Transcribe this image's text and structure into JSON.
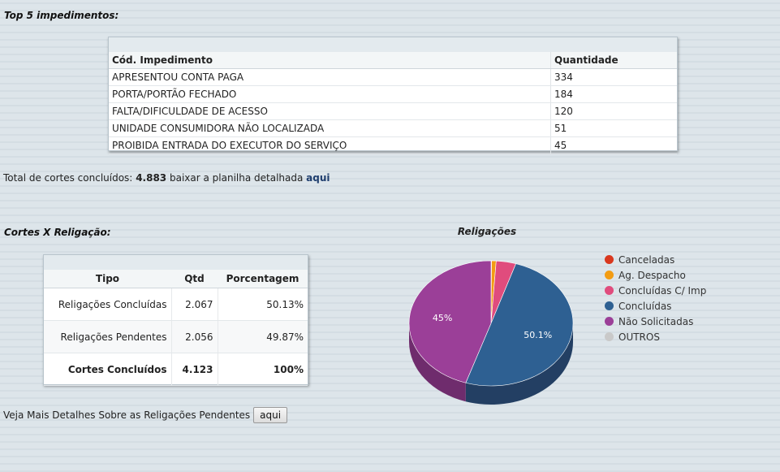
{
  "top5": {
    "title": "Top 5 impedimentos:",
    "headers": [
      "Cód. Impedimento",
      "Quantidade"
    ],
    "rows": [
      {
        "name": "APRESENTOU CONTA PAGA",
        "qty": "334"
      },
      {
        "name": "PORTA/PORTÃO FECHADO",
        "qty": "184"
      },
      {
        "name": "FALTA/DIFICULDADE DE ACESSO",
        "qty": "120"
      },
      {
        "name": "UNIDADE CONSUMIDORA NÃO LOCALIZADA",
        "qty": "51"
      },
      {
        "name": "PROIBIDA ENTRADA DO EXECUTOR DO SERVIÇO",
        "qty": "45"
      }
    ]
  },
  "total": {
    "prefix": "Total de cortes concluídos:",
    "value": "4.883",
    "middle": "baixar a planilha detalhada",
    "link": "aqui"
  },
  "cortes": {
    "title": "Cortes X Religação:",
    "headers": [
      "Tipo",
      "Qtd",
      "Porcentagem"
    ],
    "rows": [
      {
        "tipo": "Religações Concluídas",
        "qtd": "2.067",
        "pct": "50.13%"
      },
      {
        "tipo": "Religações Pendentes",
        "qtd": "2.056",
        "pct": "49.87%"
      },
      {
        "tipo": "Cortes Concluídos",
        "qtd": "4.123",
        "pct": "100%"
      }
    ]
  },
  "details": {
    "text": "Veja Mais Detalhes Sobre as Religações Pendentes",
    "button": "aqui"
  },
  "chart_data": {
    "type": "pie",
    "title": "Religações",
    "legend_position": "right",
    "labels": [
      "Canceladas",
      "Ag. Despacho",
      "Concluídas C/ Imp",
      "Concluídas",
      "Não Solicitadas",
      "OUTROS"
    ],
    "values": [
      0.1,
      0.9,
      3.9,
      50.1,
      45,
      0
    ],
    "data_labels": [
      "",
      "",
      "",
      "50.1%",
      "45%",
      ""
    ],
    "colors": [
      "#d9381e",
      "#f39c12",
      "#e04c7d",
      "#2e6092",
      "#9b3f98",
      "#c9c9c9"
    ],
    "side_colors": [
      "#a82a16",
      "#b8750c",
      "#a93a5e",
      "#233f63",
      "#6f2c6d",
      "#999999"
    ]
  }
}
